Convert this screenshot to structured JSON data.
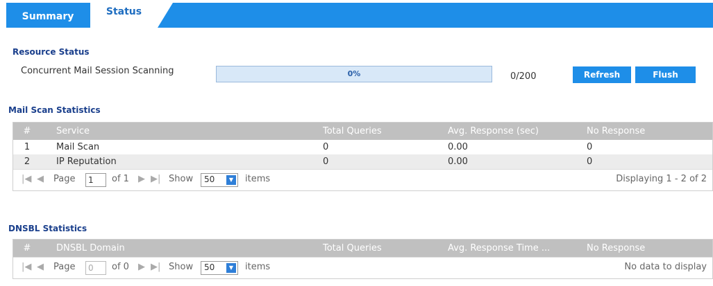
{
  "tabs": {
    "summary": "Summary",
    "status": "Status"
  },
  "resource": {
    "title": "Resource Status",
    "label": "Concurrent Mail Session Scanning",
    "progress_text": "0%",
    "progress_fraction": 0,
    "count": "0/200",
    "refresh": "Refresh",
    "flush": "Flush"
  },
  "mail_scan": {
    "title": "Mail Scan Statistics",
    "headers": {
      "num": "#",
      "service": "Service",
      "total": "Total Queries",
      "avg": "Avg. Response (sec)",
      "no_response": "No Response"
    },
    "rows": [
      {
        "num": "1",
        "service": "Mail Scan",
        "total": "0",
        "avg": "0.00",
        "no_response": "0"
      },
      {
        "num": "2",
        "service": "IP Reputation",
        "total": "0",
        "avg": "0.00",
        "no_response": "0"
      }
    ],
    "pager": {
      "page_label": "Page",
      "page_value": "1",
      "of_label": "of 1",
      "show_label": "Show",
      "show_value": "50",
      "items_label": "items",
      "display_text": "Displaying 1 - 2 of 2"
    }
  },
  "dnsbl": {
    "title": "DNSBL Statistics",
    "headers": {
      "num": "#",
      "domain": "DNSBL Domain",
      "total": "Total Queries",
      "avg": "Avg. Response Time ...",
      "no_response": "No Response"
    },
    "pager": {
      "page_label": "Page",
      "page_value": "0",
      "of_label": "of 0",
      "show_label": "Show",
      "show_value": "50",
      "items_label": "items",
      "display_text": "No data to display"
    }
  },
  "colors": {
    "accent": "#1e8ee8",
    "title": "#1a3f8c",
    "header_gray": "#c0c0c0"
  }
}
